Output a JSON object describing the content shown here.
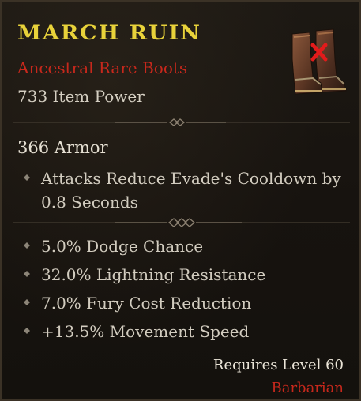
{
  "item": {
    "name": "March Ruin",
    "type": "Ancestral Rare Boots",
    "item_power": "733 Item Power",
    "icon": "boots-icon",
    "marker_icon": "red-x-icon"
  },
  "armor": "366 Armor",
  "implicit": {
    "line1": "Attacks Reduce Evade's Cooldown by",
    "line2": "0.8 Seconds"
  },
  "affixes": [
    "5.0% Dodge Chance",
    "32.0% Lightning Resistance",
    "7.0% Fury Cost Reduction",
    "+13.5% Movement Speed"
  ],
  "requirements": {
    "level": "Requires Level 60",
    "class": "Barbarian"
  },
  "colors": {
    "name": "#e8d23a",
    "rarity": "#c7281c",
    "class": "#c7281c"
  }
}
